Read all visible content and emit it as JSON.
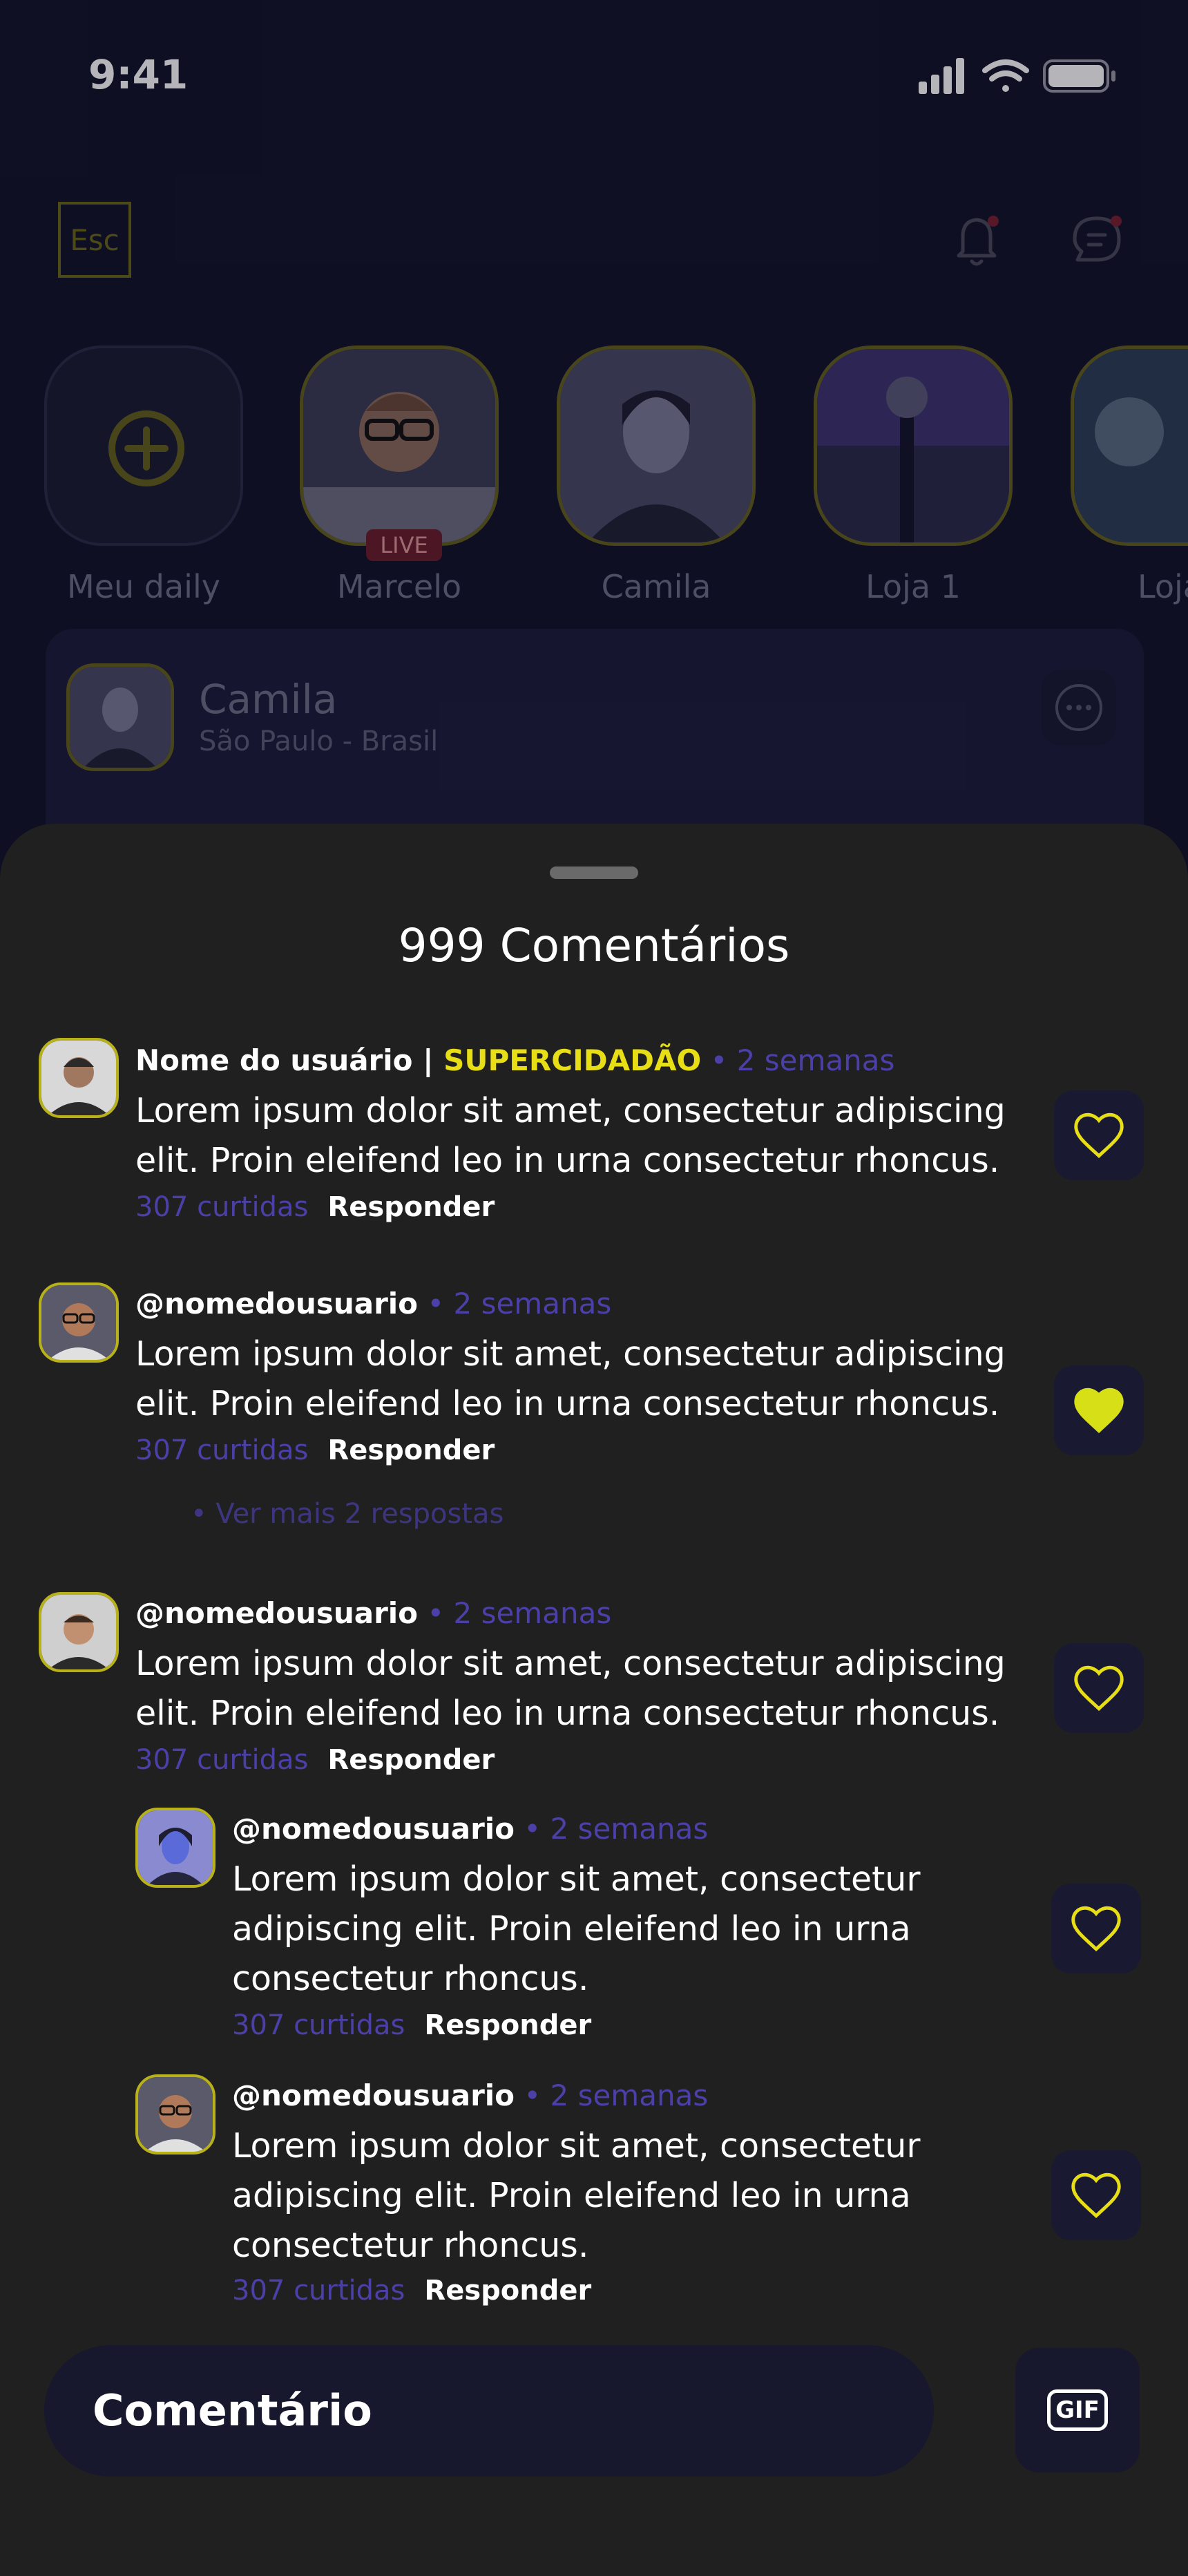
{
  "status_bar": {
    "time": "9:41"
  },
  "header": {
    "logo_text": "Esc"
  },
  "stories": [
    {
      "label": "Meu daily",
      "live": ""
    },
    {
      "label": "Marcelo",
      "live": "LIVE"
    },
    {
      "label": "Camila",
      "live": ""
    },
    {
      "label": "Loja 1",
      "live": ""
    },
    {
      "label": "Loja",
      "live": ""
    }
  ],
  "post": {
    "name": "Camila",
    "location": "São Paulo - Brasil"
  },
  "sheet": {
    "title": "999 Comentários"
  },
  "comments": [
    {
      "user": "Nome do usuário |",
      "badge": "SUPERCIDADÃO",
      "sep": " • ",
      "date": "2 semanas",
      "text": "Lorem ipsum dolor sit amet, consectetur adipiscing elit. Proin eleifend leo in urna consectetur rhoncus.",
      "likes": "307 curtidas",
      "reply": "Responder",
      "liked": false
    },
    {
      "user": "@nomedousuario",
      "badge": "",
      "sep": " • ",
      "date": "2 semanas",
      "text": "Lorem ipsum dolor sit amet, consectetur adipiscing elit. Proin eleifend leo in urna consectetur rhoncus.",
      "likes": "307 curtidas",
      "reply": "Responder",
      "liked": true,
      "more": "•  Ver mais 2 respostas"
    },
    {
      "user": "@nomedousuario",
      "badge": "",
      "sep": " • ",
      "date": "2 semanas",
      "text": "Lorem ipsum dolor sit amet, consectetur adipiscing elit. Proin eleifend leo in urna consectetur rhoncus.",
      "likes": "307 curtidas",
      "reply": "Responder",
      "liked": false
    },
    {
      "user": "@nomedousuario",
      "badge": "",
      "sep": " • ",
      "date": "2 semanas",
      "text": "Lorem ipsum dolor sit amet, consectetur adipiscing elit. Proin eleifend leo in urna consectetur rhoncus.",
      "likes": "307 curtidas",
      "reply": "Responder",
      "liked": false
    },
    {
      "user": "@nomedousuario",
      "badge": "",
      "sep": " • ",
      "date": "2 semanas",
      "text": "Lorem ipsum dolor sit amet, consectetur adipiscing elit. Proin eleifend leo in urna consectetur rhoncus.",
      "likes": "307 curtidas",
      "reply": "Responder",
      "liked": false
    }
  ],
  "composer": {
    "placeholder": "Comentário",
    "gif_label": "GIF"
  },
  "colors": {
    "accent": "#e7de16",
    "muted_purple": "#4b3fa8",
    "sheet_bg": "#202020"
  }
}
